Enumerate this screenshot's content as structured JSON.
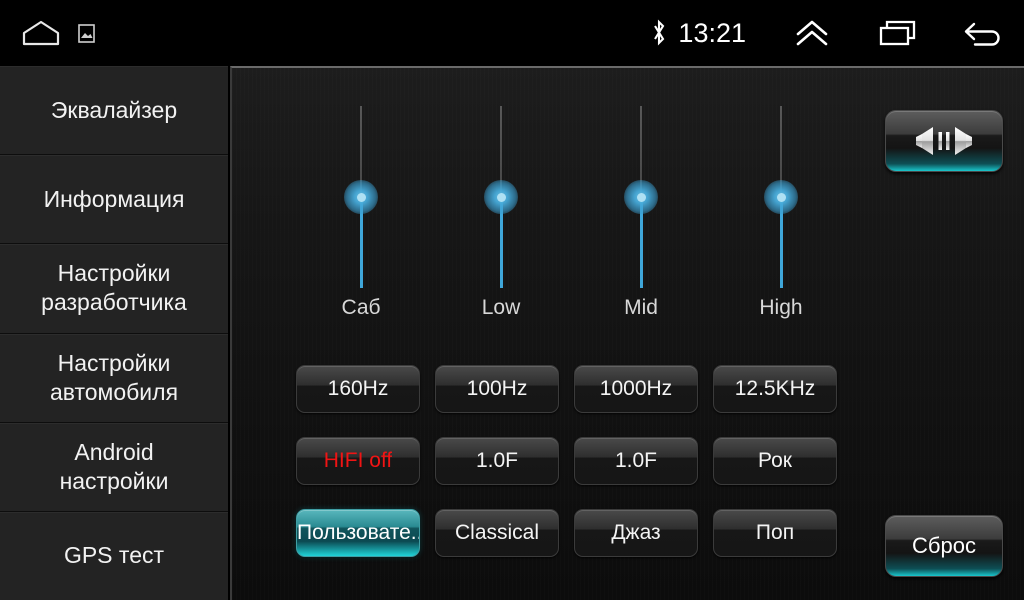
{
  "statusbar": {
    "time": "13:21",
    "icons": {
      "home": "home-icon",
      "screenshot": "screenshot-icon",
      "bluetooth": "bluetooth-icon",
      "collapse": "double-chevron-up-icon",
      "recents": "recents-icon",
      "back": "back-arrow-icon"
    }
  },
  "sidebar": {
    "items": [
      {
        "label": "Эквалайзер"
      },
      {
        "label": "Информация"
      },
      {
        "label": "Настройки\nразработчика"
      },
      {
        "label": "Настройки\nавтомобиля"
      },
      {
        "label": "Android\nнастройки"
      },
      {
        "label": "GPS тест"
      }
    ]
  },
  "equalizer": {
    "sliders": [
      {
        "label": "Саб",
        "value_pct": 50
      },
      {
        "label": "Low",
        "value_pct": 50
      },
      {
        "label": "Mid",
        "value_pct": 50
      },
      {
        "label": "High",
        "value_pct": 50
      }
    ],
    "rows": [
      [
        {
          "label": "160Hz",
          "state": "normal"
        },
        {
          "label": "100Hz",
          "state": "normal"
        },
        {
          "label": "1000Hz",
          "state": "normal"
        },
        {
          "label": "12.5KHz",
          "state": "normal"
        }
      ],
      [
        {
          "label": "HIFI off",
          "state": "red"
        },
        {
          "label": "1.0F",
          "state": "normal"
        },
        {
          "label": "1.0F",
          "state": "normal"
        },
        {
          "label": "Рок",
          "state": "normal"
        }
      ],
      [
        {
          "label": "Пользовате...",
          "state": "active"
        },
        {
          "label": "Classical",
          "state": "normal"
        },
        {
          "label": "Джаз",
          "state": "normal"
        },
        {
          "label": "Поп",
          "state": "normal"
        }
      ]
    ],
    "balance_button": {
      "icon": "balance-fader-icon"
    },
    "reset_button": {
      "label": "Сброс"
    }
  },
  "colors": {
    "accent_cyan": "#3fa7da",
    "active_teal": "#19c6cc",
    "alert_red": "#f01414",
    "panel_bg": "#141414",
    "sidebar_bg": "#232323"
  }
}
